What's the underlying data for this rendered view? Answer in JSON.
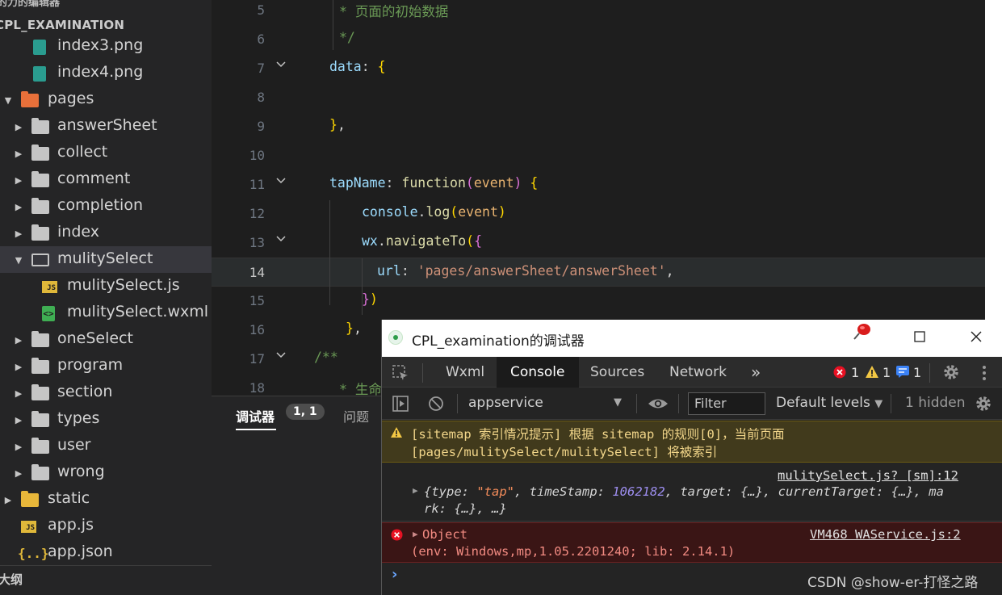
{
  "sidebar": {
    "top_title": "的力的编辑器",
    "project_name": "CPL_EXAMINATION",
    "items": [
      {
        "label": "index3.png",
        "type": "png",
        "level": 2,
        "expanded": null
      },
      {
        "label": "index4.png",
        "type": "png",
        "level": 2,
        "expanded": null
      },
      {
        "label": "pages",
        "type": "pages-folder",
        "level": 0,
        "expanded": true
      },
      {
        "label": "answerSheet",
        "type": "folder",
        "level": 1,
        "expanded": false
      },
      {
        "label": "collect",
        "type": "folder",
        "level": 1,
        "expanded": false
      },
      {
        "label": "comment",
        "type": "folder",
        "level": 1,
        "expanded": false
      },
      {
        "label": "completion",
        "type": "folder",
        "level": 1,
        "expanded": false
      },
      {
        "label": "index",
        "type": "folder",
        "level": 1,
        "expanded": false
      },
      {
        "label": "mulitySelect",
        "type": "folder-open",
        "level": 1,
        "expanded": true
      },
      {
        "label": "mulitySelect.js",
        "type": "js",
        "level": 2,
        "expanded": null
      },
      {
        "label": "mulitySelect.wxml",
        "type": "wxml",
        "level": 2,
        "expanded": null
      },
      {
        "label": "oneSelect",
        "type": "folder",
        "level": 1,
        "expanded": false
      },
      {
        "label": "program",
        "type": "folder",
        "level": 1,
        "expanded": false
      },
      {
        "label": "section",
        "type": "folder",
        "level": 1,
        "expanded": false
      },
      {
        "label": "types",
        "type": "folder",
        "level": 1,
        "expanded": false
      },
      {
        "label": "user",
        "type": "folder",
        "level": 1,
        "expanded": false
      },
      {
        "label": "wrong",
        "type": "folder",
        "level": 1,
        "expanded": false
      },
      {
        "label": "static",
        "type": "static-folder",
        "level": 0,
        "expanded": false
      },
      {
        "label": "app.js",
        "type": "js",
        "level": 0,
        "expanded": null
      },
      {
        "label": "app.json",
        "type": "json",
        "level": 0,
        "expanded": null
      }
    ],
    "outline_label": "大纲"
  },
  "editor": {
    "lines": [
      {
        "num": "5",
        "text": "* 页面的初始数据"
      },
      {
        "num": "6",
        "text": "*/"
      },
      {
        "num": "7",
        "text": "data: {"
      },
      {
        "num": "8",
        "text": ""
      },
      {
        "num": "9",
        "text": "},"
      },
      {
        "num": "10",
        "text": ""
      },
      {
        "num": "11",
        "text": "tapName: function(event) {"
      },
      {
        "num": "12",
        "text": "console.log(event)"
      },
      {
        "num": "13",
        "text": "wx.navigateTo({"
      },
      {
        "num": "14",
        "text": "url: 'pages/answerSheet/answerSheet',"
      },
      {
        "num": "15",
        "text": "})"
      },
      {
        "num": "16",
        "text": "},"
      },
      {
        "num": "17",
        "text": "/**"
      },
      {
        "num": "18",
        "text": "* 生命"
      }
    ],
    "current_line": "14"
  },
  "bottom_panel": {
    "tab_debugger": "调试器",
    "badge": "1, 1",
    "tab_problems": "问题"
  },
  "devtools": {
    "title": "CPL_examination的调试器",
    "tabs": [
      "Wxml",
      "Console",
      "Sources",
      "Network"
    ],
    "active_tab": "Console",
    "more_tabs": "»",
    "error_count": "1",
    "warning_count": "1",
    "info_count": "1",
    "context": "appservice",
    "filter_placeholder": "Filter",
    "levels": "Default levels",
    "hidden": "1 hidden",
    "messages": {
      "warn_line1": "[sitemap 索引情况提示] 根据 sitemap 的规则[0]，当前页面",
      "warn_line2": "[pages/mulitySelect/mulitySelect] 将被索引",
      "log_source": "mulitySelect.js? [sm]:12",
      "log_part_open": "{type: ",
      "log_type_val": "\"tap\"",
      "log_part_ts": ", timeStamp: ",
      "log_ts_val": "1062182",
      "log_part_rest1": ", target: {…}, currentTarget: {…}, ma",
      "log_part_rest2": "rk: {…}, …}",
      "error_label": "Object",
      "error_source": "VM468 WAService.js:2",
      "error_detail": "(env: Windows,mp,1.05.2201240; lib: 2.14.1)"
    },
    "prompt": "›"
  },
  "watermark": "CSDN @show-er-打怪之路",
  "colors": {
    "accent_error": "#e81123",
    "accent_warning": "#f2c744",
    "accent_info": "#3b82f6"
  }
}
